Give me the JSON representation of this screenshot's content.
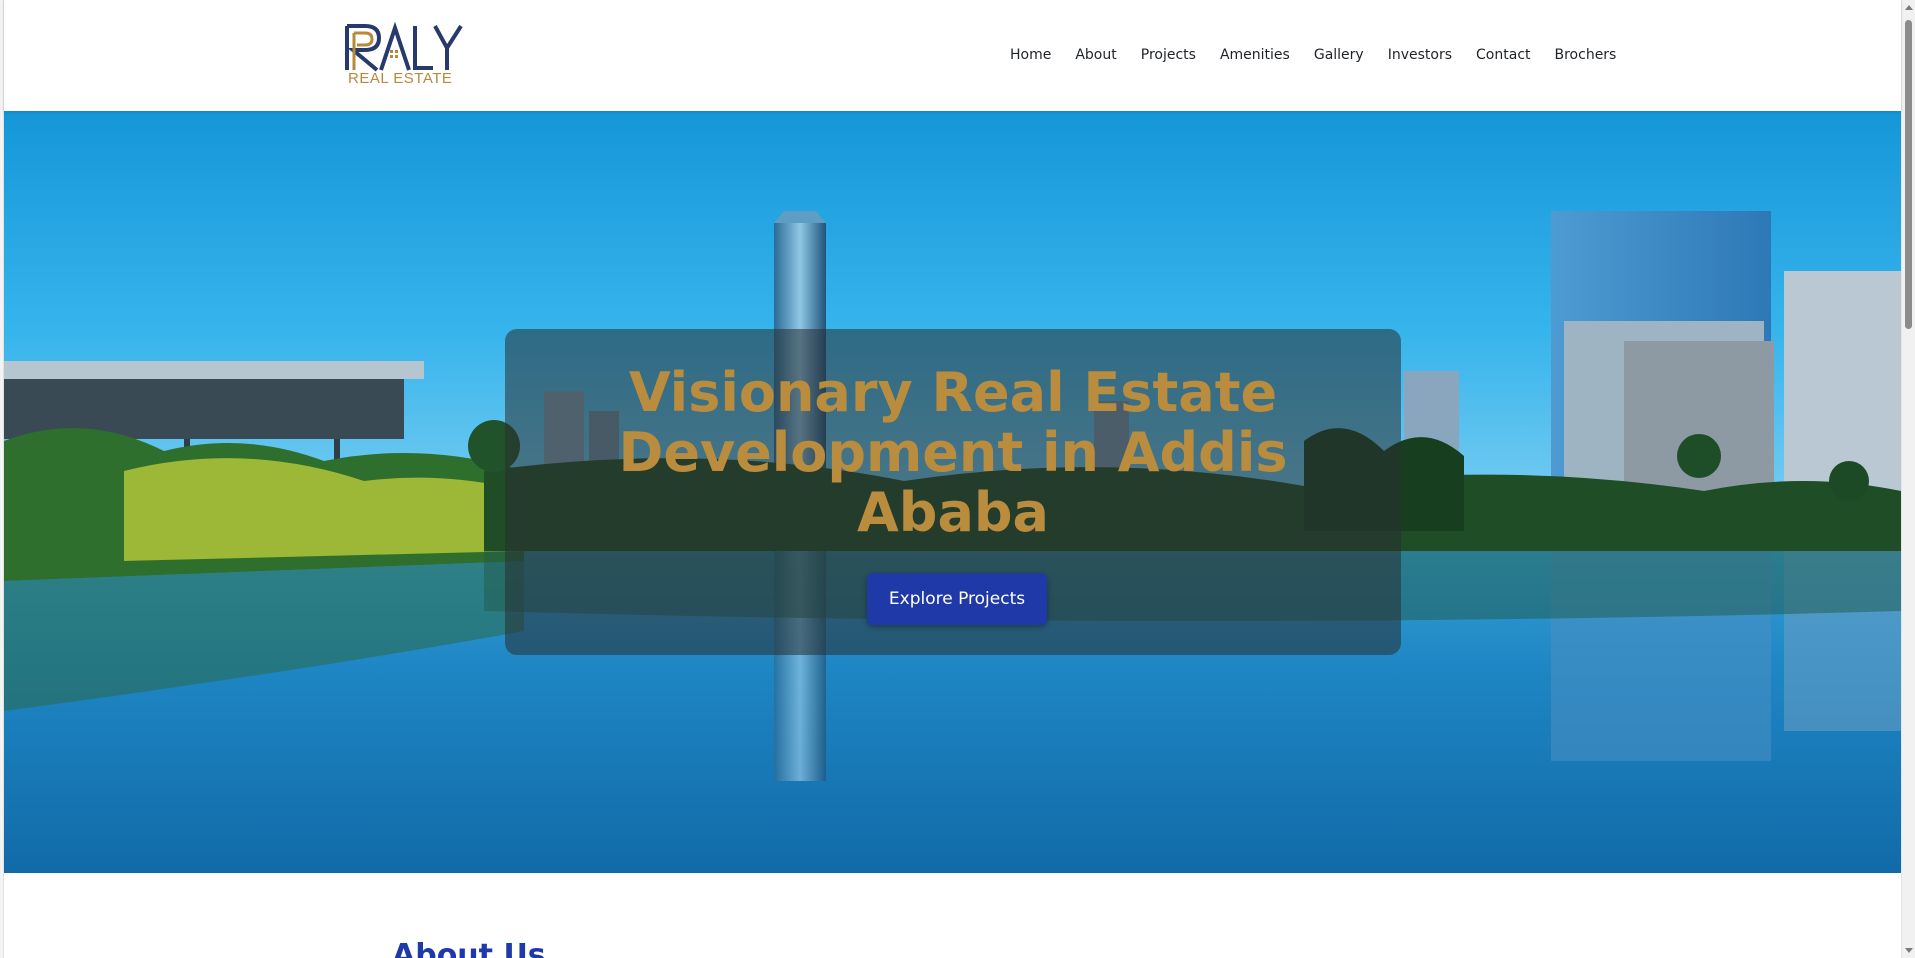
{
  "brand": {
    "logo_mark": "RALY",
    "logo_subtitle": "REAL ESTATE",
    "colors": {
      "navy": "#263a6b",
      "gold": "#b8893a"
    }
  },
  "nav": {
    "items": [
      {
        "label": "Home"
      },
      {
        "label": "About"
      },
      {
        "label": "Projects"
      },
      {
        "label": "Amenities"
      },
      {
        "label": "Gallery"
      },
      {
        "label": "Investors"
      },
      {
        "label": "Contact"
      },
      {
        "label": "Brochers"
      }
    ]
  },
  "hero": {
    "title_lines": [
      "Visionary Real Estate",
      "Development in Addis",
      "Ababa"
    ],
    "cta_label": "Explore Projects",
    "title_color": "#b98c3e",
    "cta_color": "#1f3aa8"
  },
  "about": {
    "heading": "About Us"
  }
}
